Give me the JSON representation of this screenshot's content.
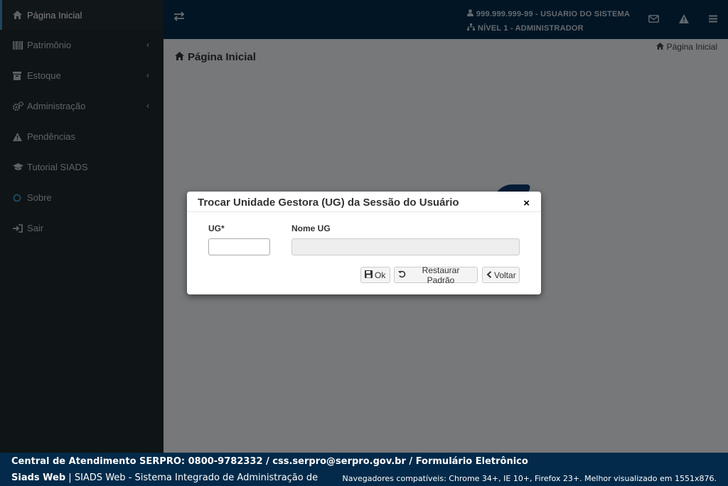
{
  "sidebar": {
    "items": [
      {
        "label": "Página Inicial",
        "icon": "home-icon",
        "has_submenu": false,
        "active": true
      },
      {
        "label": "Patrimônio",
        "icon": "barcode-icon",
        "has_submenu": true
      },
      {
        "label": "Estoque",
        "icon": "box-icon",
        "has_submenu": true
      },
      {
        "label": "Administração",
        "icon": "gears-icon",
        "has_submenu": true
      },
      {
        "label": "Pendências",
        "icon": "warning-icon",
        "has_submenu": false
      },
      {
        "label": "Tutorial SIADS",
        "icon": "graduation-cap-icon",
        "has_submenu": false
      },
      {
        "label": "Sobre",
        "icon": "circle-icon",
        "has_submenu": false
      },
      {
        "label": "Sair",
        "icon": "sign-out-icon",
        "has_submenu": false
      }
    ]
  },
  "header": {
    "user": "999.999.999-99 - USUARIO DO SISTEMA",
    "level": "NÍVEL 1 - ADMINISTRADOR"
  },
  "content": {
    "page_title": "Página Inicial",
    "breadcrumb": "Página Inicial"
  },
  "modal": {
    "title": "Trocar Unidade Gestora (UG) da Sessão do Usuário",
    "close": "×",
    "ug_label": "UG*",
    "ug_value": "",
    "nome_ug_label": "Nome UG",
    "nome_ug_value": "",
    "buttons": {
      "ok": "Ok",
      "restore": "Restaurar Padrão",
      "back": "Voltar"
    }
  },
  "footer": {
    "line1": "Central de Atendimento SERPRO: 0800-9782332 / css.serpro@serpro.gov.br / Formulário Eletrônico",
    "brand": "Siads Web",
    "line2_rest": " | SIADS Web - Sistema Integrado de Administração de",
    "browsers": "Navegadores compatíveis: Chrome 34+, IE 10+, Firefox 23+. Melhor visualizado em 1551x876."
  },
  "colors": {
    "header_bg": "#032a4a",
    "sidebar_bg": "#1e282c",
    "content_bg": "#ecf0f5"
  }
}
